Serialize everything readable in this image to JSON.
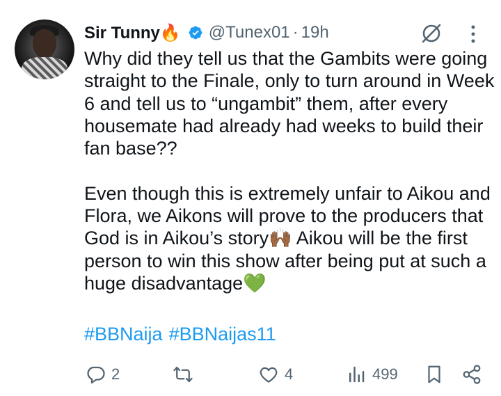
{
  "tweet": {
    "author_name": "Sir Tunny",
    "author_emoji": "🔥",
    "handle": "@Tunex01",
    "separator": "·",
    "time": "19h",
    "paragraph1": "Why did they tell us that the Gambits were going straight to the Finale, only to turn around in Week 6 and tell us to “ungambit” them, after every housemate had already had weeks to build their fan base??",
    "paragraph2": "Even though this is extremely unfair to Aikou and Flora, we Aikons will prove to the producers that God is in Aikou’s story🙌🏾 Aikou will be the first person to win this show after being put at such a huge disadvantage💚",
    "hashtags": [
      "#BBNaija",
      "#BBNaijas11"
    ]
  },
  "actions": {
    "replies": "2",
    "retweets": "",
    "likes": "4",
    "views": "499"
  },
  "colors": {
    "accent": "#1d9bf0",
    "muted": "#536471",
    "text": "#0f1419"
  },
  "icons": [
    "verified-badge-icon",
    "grok-icon",
    "more-icon",
    "reply-icon",
    "retweet-icon",
    "like-icon",
    "views-icon",
    "bookmark-icon",
    "share-icon"
  ]
}
